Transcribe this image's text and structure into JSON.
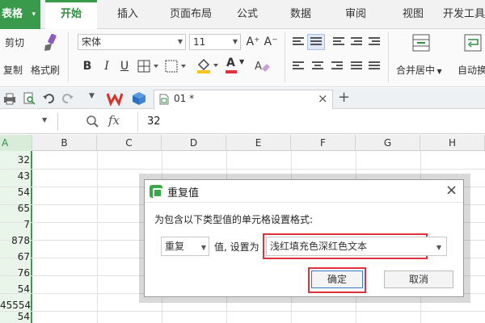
{
  "app": {
    "menu_label": "表格"
  },
  "tabs": [
    {
      "label": "开始",
      "active": true
    },
    {
      "label": "插入"
    },
    {
      "label": "页面布局"
    },
    {
      "label": "公式"
    },
    {
      "label": "数据"
    },
    {
      "label": "审阅"
    },
    {
      "label": "视图"
    },
    {
      "label": "开发工具"
    }
  ],
  "ribbon": {
    "cut": "剪切",
    "copy": "复制",
    "format_painter": "格式刷",
    "font_name": "宋体",
    "font_size": "11",
    "bold": "B",
    "italic": "I",
    "underline": "U",
    "font_color_letter": "A",
    "grow_font": "A⁺",
    "shrink_font": "A⁻",
    "merge_center": "合并居中",
    "auto_wrap": "自动换"
  },
  "quickbar": {
    "doc_name": "01 *",
    "close": "×",
    "new_tab": "+"
  },
  "formula_bar": {
    "fx": "fx",
    "value": "32"
  },
  "columns": [
    "A",
    "B",
    "C",
    "D",
    "E",
    "F",
    "G",
    "H"
  ],
  "cells_col_a": [
    "32",
    "43",
    "54",
    "65",
    "7",
    "878",
    "67",
    "76",
    "54",
    "45554",
    "54"
  ],
  "dialog": {
    "title": "重复值",
    "close": "×",
    "prompt": "为包含以下类型值的单元格设置格式:",
    "type_value": "重复",
    "mid_text": "值, 设置为",
    "format_value": "浅红填充色深红色文本",
    "ok": "确定",
    "cancel": "取消"
  },
  "colors": {
    "accent": "#3a9a4c",
    "highlight": "#e0303a"
  }
}
